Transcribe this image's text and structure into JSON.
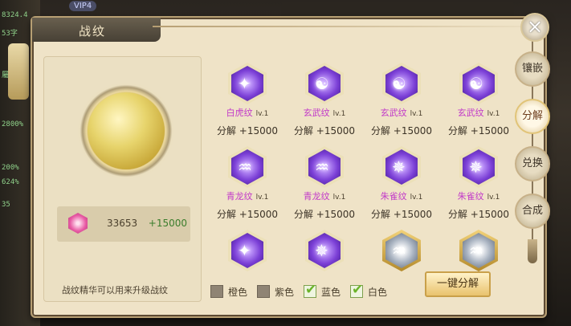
{
  "background": {
    "vip_label": "VIP4",
    "stats_left": [
      "8324.4",
      "53字",
      "屬",
      "2800%",
      "200%",
      "624%",
      "35"
    ]
  },
  "panel": {
    "title": "战纹",
    "close_icon": "close-icon"
  },
  "currency": {
    "icon": "crystal-icon",
    "value": "33653",
    "plus": "+15000"
  },
  "hint": "战纹精华可以用来升级战纹",
  "cards": [
    {
      "name": "白虎纹",
      "lv": "lv.1",
      "decompose": "分解 +15000",
      "quality": "purple",
      "icon": "tiger-rune-icon"
    },
    {
      "name": "玄武纹",
      "lv": "lv.1",
      "decompose": "分解 +15000",
      "quality": "purple",
      "icon": "tortoise-rune-icon"
    },
    {
      "name": "玄武纹",
      "lv": "lv.1",
      "decompose": "分解 +15000",
      "quality": "purple",
      "icon": "tortoise-rune-icon"
    },
    {
      "name": "玄武纹",
      "lv": "lv.1",
      "decompose": "分解 +15000",
      "quality": "purple",
      "icon": "tortoise-rune-icon"
    },
    {
      "name": "青龙纹",
      "lv": "lv.1",
      "decompose": "分解 +15000",
      "quality": "purple",
      "icon": "dragon-rune-icon"
    },
    {
      "name": "青龙纹",
      "lv": "lv.1",
      "decompose": "分解 +15000",
      "quality": "purple",
      "icon": "dragon-rune-icon"
    },
    {
      "name": "朱雀纹",
      "lv": "lv.1",
      "decompose": "分解 +15000",
      "quality": "purple",
      "icon": "phoenix-rune-icon"
    },
    {
      "name": "朱雀纹",
      "lv": "lv.1",
      "decompose": "分解 +15000",
      "quality": "purple",
      "icon": "phoenix-rune-icon"
    },
    {
      "name": "",
      "lv": "",
      "decompose": "",
      "quality": "purple",
      "icon": "tiger-rune-icon"
    },
    {
      "name": "",
      "lv": "",
      "decompose": "",
      "quality": "purple",
      "icon": "phoenix-rune-icon"
    },
    {
      "name": "",
      "lv": "",
      "decompose": "",
      "quality": "white",
      "icon": "dragon-rune-icon"
    },
    {
      "name": "",
      "lv": "",
      "decompose": "",
      "quality": "white",
      "icon": "dragon-rune-icon"
    }
  ],
  "filters": [
    {
      "label": "橙色",
      "checked": false
    },
    {
      "label": "紫色",
      "checked": false
    },
    {
      "label": "蓝色",
      "checked": true
    },
    {
      "label": "白色",
      "checked": true
    }
  ],
  "one_key_decompose": "一键分解",
  "side_tabs": [
    {
      "label": "镶嵌",
      "active": false
    },
    {
      "label": "分解",
      "active": true
    },
    {
      "label": "兑换",
      "active": false
    },
    {
      "label": "合成",
      "active": false
    }
  ],
  "colors": {
    "rune_name": "#c23ac9",
    "plus_value": "#3b7d2c",
    "check": "#6bb42a"
  }
}
